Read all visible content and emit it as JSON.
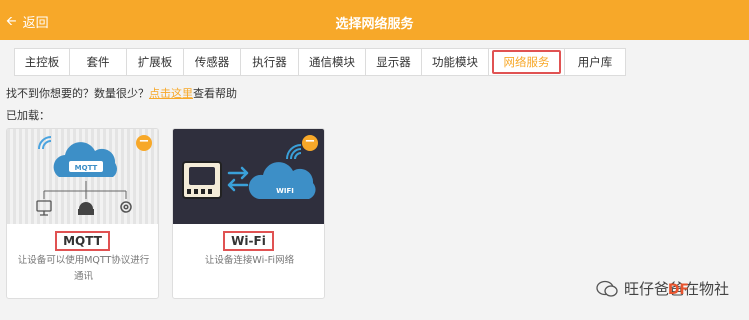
{
  "header": {
    "back_label": "返回",
    "title": "选择网络服务"
  },
  "tabs": [
    {
      "label": "主控板",
      "active": false
    },
    {
      "label": "套件",
      "active": false
    },
    {
      "label": "扩展板",
      "active": false
    },
    {
      "label": "传感器",
      "active": false
    },
    {
      "label": "执行器",
      "active": false
    },
    {
      "label": "通信模块",
      "active": false
    },
    {
      "label": "显示器",
      "active": false
    },
    {
      "label": "功能模块",
      "active": false
    },
    {
      "label": "网络服务",
      "active": true
    },
    {
      "label": "用户库",
      "active": false
    }
  ],
  "hint": {
    "prefix": "找不到你想要的？数量很少？",
    "link": "点击这里",
    "suffix": "查看帮助"
  },
  "loaded_label": "已加载：",
  "cards": [
    {
      "name": "MQTT",
      "description": "让设备可以使用MQTT协议进行通讯",
      "badge_text": "MQTT",
      "remove_symbol": "−"
    },
    {
      "name": "Wi-Fi",
      "description": "让设备连接Wi-Fi网络",
      "badge_text": "WIFI",
      "remove_symbol": "−"
    }
  ],
  "watermark": {
    "text": "旺仔爸爸在物社",
    "logo": "DF"
  },
  "colors": {
    "accent": "#f7a829",
    "highlight": "#e05252"
  }
}
